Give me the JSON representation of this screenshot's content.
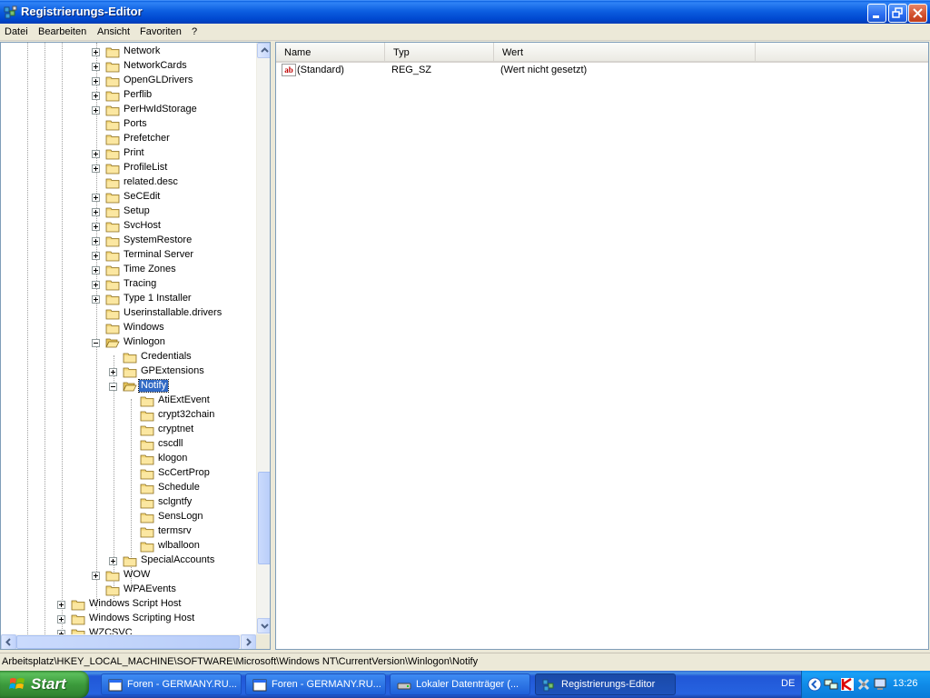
{
  "window": {
    "title": "Registrierungs-Editor"
  },
  "menu": [
    "Datei",
    "Bearbeiten",
    "Ansicht",
    "Favoriten",
    "?"
  ],
  "tree": {
    "nodes": [
      {
        "label": "Network",
        "expander": "plus"
      },
      {
        "label": "NetworkCards",
        "expander": "plus"
      },
      {
        "label": "OpenGLDrivers",
        "expander": "plus"
      },
      {
        "label": "Perflib",
        "expander": "plus"
      },
      {
        "label": "PerHwIdStorage",
        "expander": "plus"
      },
      {
        "label": "Ports",
        "expander": "none"
      },
      {
        "label": "Prefetcher",
        "expander": "none"
      },
      {
        "label": "Print",
        "expander": "plus"
      },
      {
        "label": "ProfileList",
        "expander": "plus"
      },
      {
        "label": "related.desc",
        "expander": "none"
      },
      {
        "label": "SeCEdit",
        "expander": "plus"
      },
      {
        "label": "Setup",
        "expander": "plus"
      },
      {
        "label": "SvcHost",
        "expander": "plus"
      },
      {
        "label": "SystemRestore",
        "expander": "plus"
      },
      {
        "label": "Terminal Server",
        "expander": "plus"
      },
      {
        "label": "Time Zones",
        "expander": "plus"
      },
      {
        "label": "Tracing",
        "expander": "plus"
      },
      {
        "label": "Type 1 Installer",
        "expander": "plus"
      },
      {
        "label": "Userinstallable.drivers",
        "expander": "none"
      },
      {
        "label": "Windows",
        "expander": "none"
      },
      {
        "label": "Winlogon",
        "expander": "minus"
      },
      {
        "label": "Credentials",
        "expander": "none"
      },
      {
        "label": "GPExtensions",
        "expander": "plus"
      },
      {
        "label": "Notify",
        "expander": "minus",
        "selected": true
      },
      {
        "label": "AtiExtEvent",
        "expander": "none"
      },
      {
        "label": "crypt32chain",
        "expander": "none"
      },
      {
        "label": "cryptnet",
        "expander": "none"
      },
      {
        "label": "cscdll",
        "expander": "none"
      },
      {
        "label": "klogon",
        "expander": "none"
      },
      {
        "label": "ScCertProp",
        "expander": "none"
      },
      {
        "label": "Schedule",
        "expander": "none"
      },
      {
        "label": "sclgntfy",
        "expander": "none"
      },
      {
        "label": "SensLogn",
        "expander": "none"
      },
      {
        "label": "termsrv",
        "expander": "none"
      },
      {
        "label": "wlballoon",
        "expander": "none"
      },
      {
        "label": "SpecialAccounts",
        "expander": "plus"
      },
      {
        "label": "WOW",
        "expander": "plus"
      },
      {
        "label": "WPAEvents",
        "expander": "none"
      },
      {
        "label": "Windows Script Host",
        "expander": "plus"
      },
      {
        "label": "Windows Scripting Host",
        "expander": "plus"
      },
      {
        "label": "WZCSVC",
        "expander": "plus"
      }
    ]
  },
  "list": {
    "columns": [
      "Name",
      "Typ",
      "Wert"
    ],
    "rows": [
      {
        "name": "(Standard)",
        "type": "REG_SZ",
        "value": "(Wert nicht gesetzt)",
        "icon": "string-value-icon"
      }
    ]
  },
  "statusbar": {
    "path": "Arbeitsplatz\\HKEY_LOCAL_MACHINE\\SOFTWARE\\Microsoft\\Windows NT\\CurrentVersion\\Winlogon\\Notify"
  },
  "taskbar": {
    "start": "Start",
    "buttons": [
      {
        "label": "Foren - GERMANY.RU...",
        "icon": "browser-icon"
      },
      {
        "label": "Foren - GERMANY.RU...",
        "icon": "browser-icon"
      },
      {
        "label": "Lokaler Datenträger (...",
        "icon": "drive-icon"
      },
      {
        "label": "Registrierungs-Editor",
        "icon": "regedit-icon",
        "active": true
      }
    ],
    "language": "DE",
    "clock": "13:26"
  },
  "colors": {
    "titlebar": "#0a5fe0",
    "selection": "#316ac5",
    "taskbar": "#2663e0",
    "start": "#3c9a3c"
  }
}
